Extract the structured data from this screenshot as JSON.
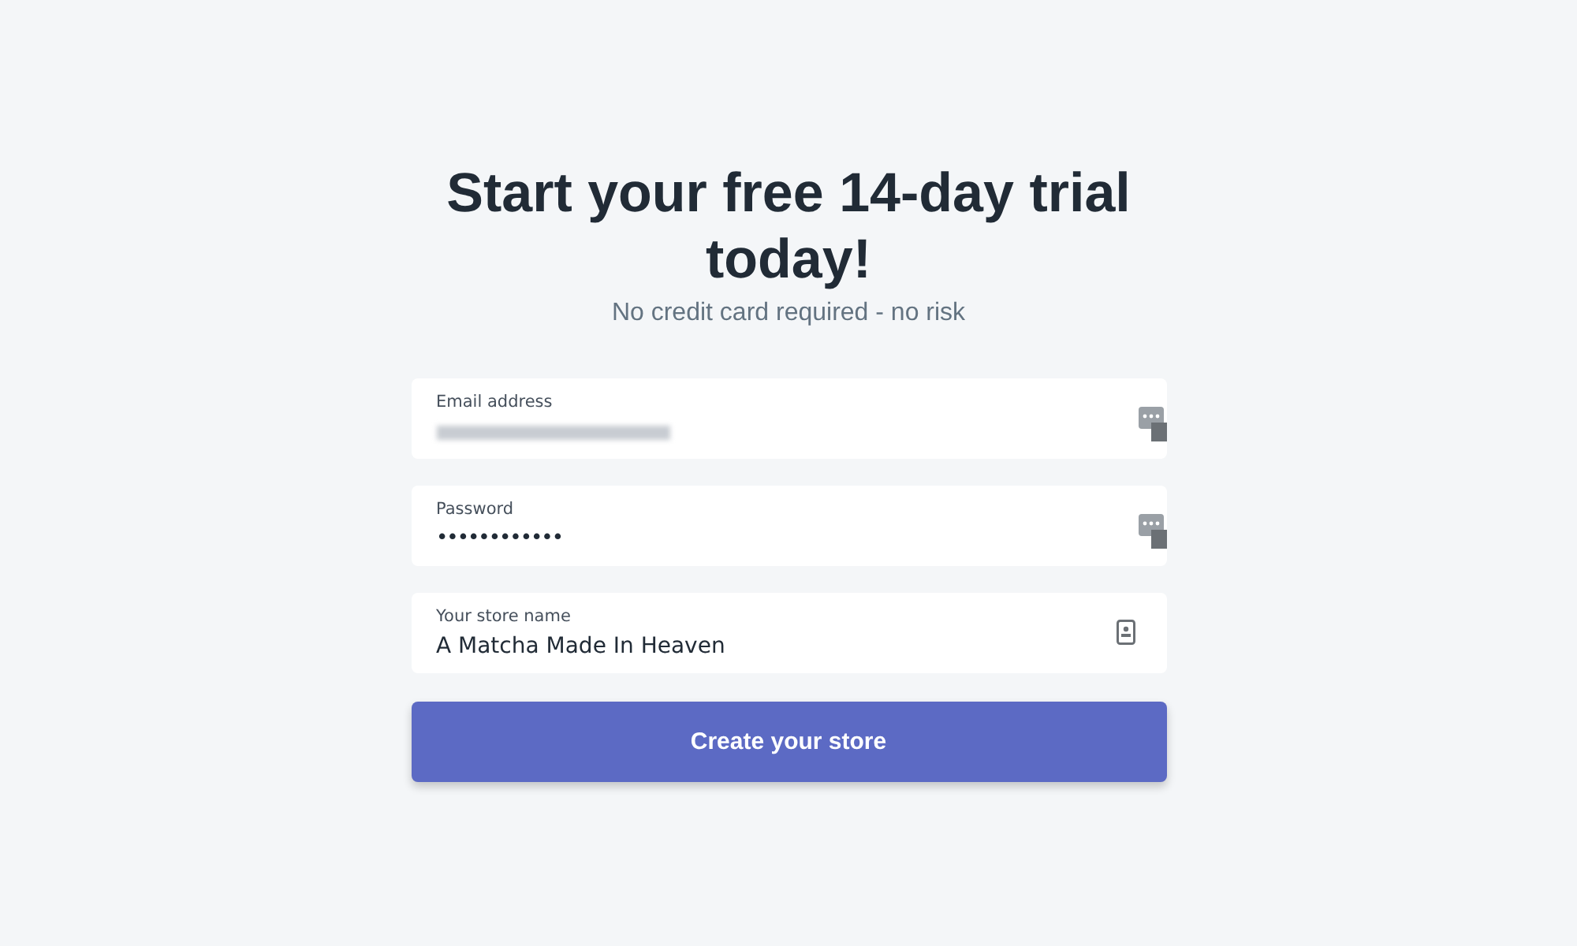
{
  "heading": "Start your free 14-day trial today!",
  "subheading": "No credit card required - no risk",
  "fields": [
    {
      "kind": "email",
      "label": "Email address",
      "redacted": true
    },
    {
      "kind": "password",
      "label": "Password",
      "value": "••••••••••••",
      "redacted": false
    },
    {
      "kind": "text",
      "label": "Your store name",
      "value": "A Matcha Made In Heaven",
      "redacted": false
    }
  ],
  "button": "Create your store"
}
